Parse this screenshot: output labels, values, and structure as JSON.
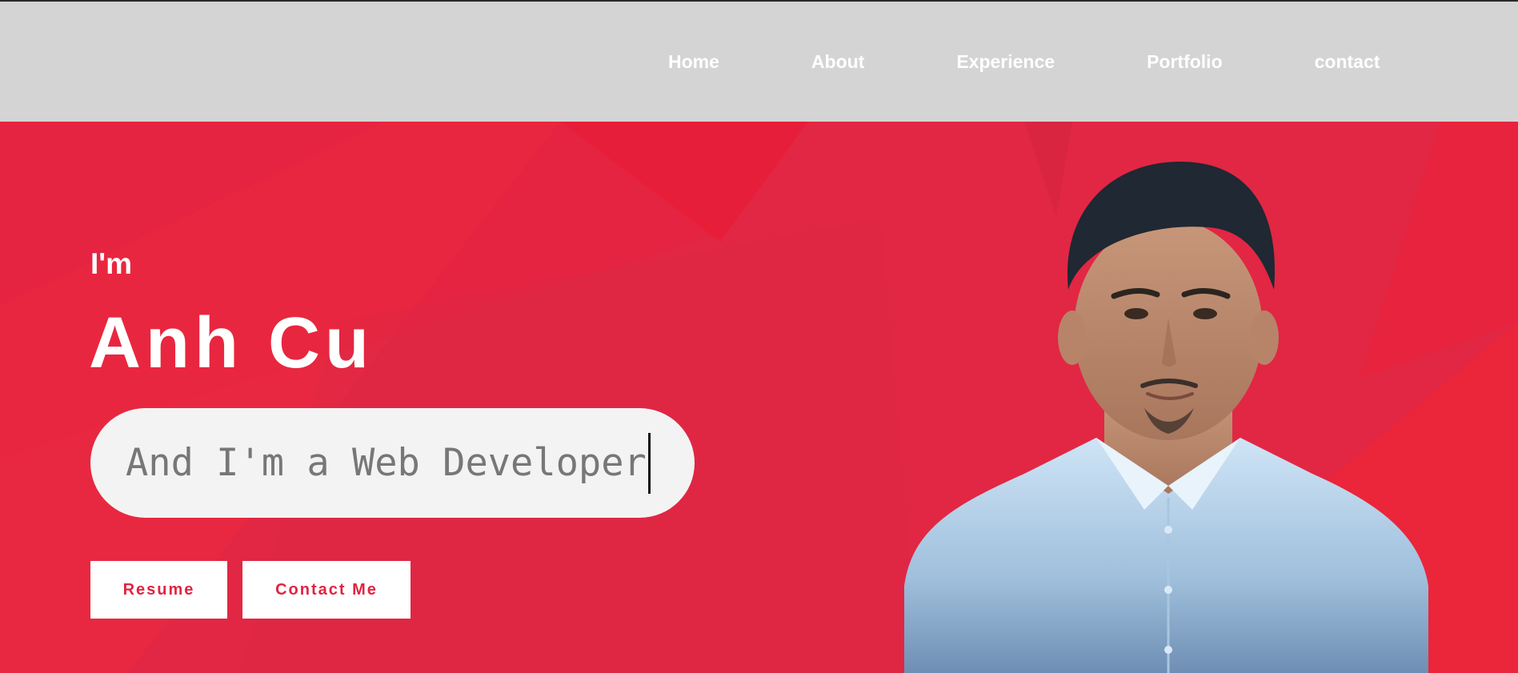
{
  "nav": {
    "items": [
      {
        "label": "Home"
      },
      {
        "label": "About"
      },
      {
        "label": "Experience"
      },
      {
        "label": "Portfolio"
      },
      {
        "label": "contact"
      }
    ]
  },
  "hero": {
    "intro": "I'm",
    "name": "Anh Cu",
    "typing_text": "And I'm a Web Developer",
    "buttons": {
      "resume": "Resume",
      "contact": "Contact Me"
    }
  },
  "colors": {
    "navbar_bg": "#d4d4d4",
    "hero_bg": "#e12743",
    "accent_red": "#e02441",
    "pill_bg": "#f3f3f3",
    "shirt_blue": "#b9d8ef"
  },
  "icons": {
    "portrait": "profile-photo"
  }
}
